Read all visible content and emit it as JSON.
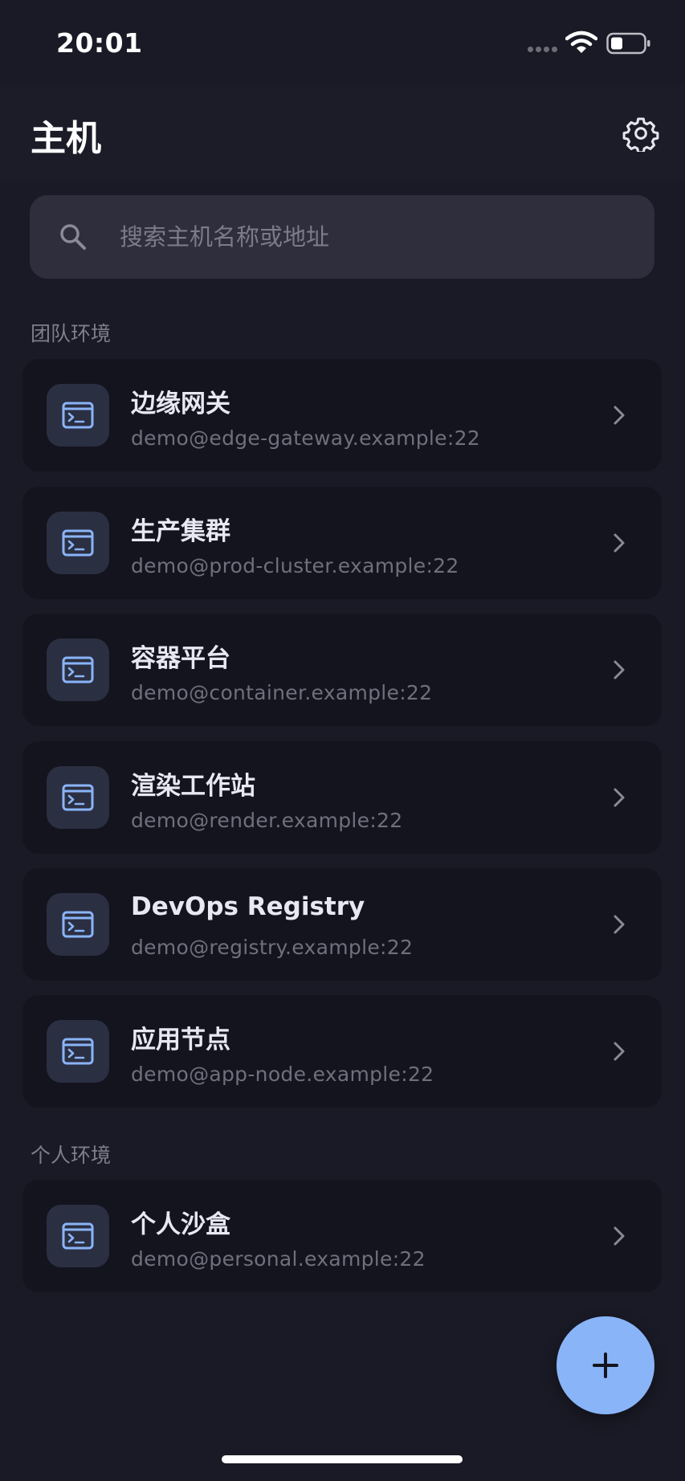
{
  "status_bar": {
    "time": "20:01"
  },
  "header": {
    "title": "主机",
    "settings_icon": "gear-icon"
  },
  "search": {
    "placeholder": "搜索主机名称或地址",
    "value": ""
  },
  "colors": {
    "background": "#1a1a26",
    "card": "#14141e",
    "accent": "#8ab4f8",
    "muted_text": "#6f6f7e"
  },
  "sections": [
    {
      "label": "团队环境",
      "hosts": [
        {
          "name": "边缘网关",
          "address": "demo@edge-gateway.example:22",
          "icon": "terminal-icon"
        },
        {
          "name": "生产集群",
          "address": "demo@prod-cluster.example:22",
          "icon": "terminal-icon"
        },
        {
          "name": "容器平台",
          "address": "demo@container.example:22",
          "icon": "terminal-icon"
        },
        {
          "name": "渲染工作站",
          "address": "demo@render.example:22",
          "icon": "terminal-icon"
        },
        {
          "name": "DevOps Registry",
          "address": "demo@registry.example:22",
          "icon": "terminal-icon"
        },
        {
          "name": "应用节点",
          "address": "demo@app-node.example:22",
          "icon": "terminal-icon"
        }
      ]
    },
    {
      "label": "个人环境",
      "hosts": [
        {
          "name": "个人沙盒",
          "address": "demo@personal.example:22",
          "icon": "terminal-icon"
        }
      ]
    }
  ],
  "fab": {
    "icon": "plus-icon"
  }
}
